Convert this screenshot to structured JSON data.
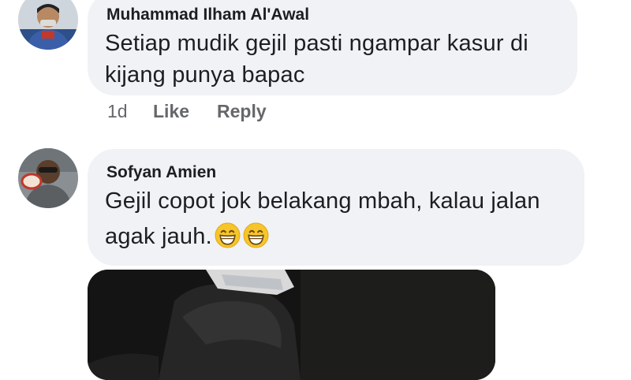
{
  "comments": [
    {
      "author": "Muhammad Ilham Al'Awal",
      "lines": [
        "Setiap mudik gejil pasti ngampar kasur di",
        "kijang punya bapac"
      ],
      "time": "1d",
      "like_label": "Like",
      "reply_label": "Reply",
      "avatar_icon": "user-avatar-photo"
    },
    {
      "author": "Sofyan Amien",
      "lines": [
        "Gejil copot jok belakang mbah, kalau jalan",
        "agak jauh."
      ],
      "emojis": [
        "grinning-face-icon",
        "grinning-face-icon"
      ],
      "avatar_icon": "user-avatar-photo"
    }
  ],
  "attachment": {
    "icon": "comment-photo-attachment"
  },
  "colors": {
    "bubble": "#f0f2f5",
    "text": "#1c1e21",
    "meta": "#65676b",
    "emoji": "#f7c52a"
  }
}
